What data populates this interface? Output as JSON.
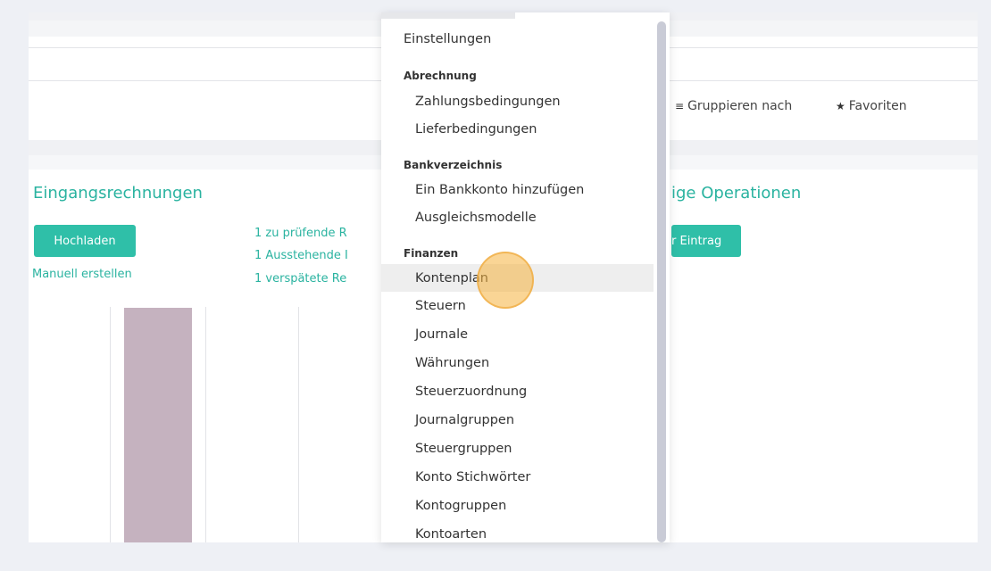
{
  "toolbar": {
    "group_by": "Gruppieren nach",
    "favorites": "Favoriten"
  },
  "incoming": {
    "title": "Eingangsrechnungen",
    "upload_button": "Hochladen",
    "manual_link": "Manuell erstellen",
    "links": [
      "1 zu prüfende R",
      "1 Ausstehende I",
      "1 verspätete Re"
    ]
  },
  "misc": {
    "title": "ige Operationen",
    "button": "r Eintrag"
  },
  "dropdown": {
    "settings": "Einstellungen",
    "groups": [
      {
        "header": "Abrechnung",
        "items": [
          "Zahlungsbedingungen",
          "Lieferbedingungen"
        ]
      },
      {
        "header": "Bankverzeichnis",
        "items": [
          "Ein Bankkonto hinzufügen",
          "Ausgleichsmodelle"
        ]
      },
      {
        "header": "Finanzen",
        "items": [
          "Kontenplan",
          "Steuern",
          "Journale",
          "Währungen",
          "Steuerzuordnung",
          "Journalgruppen",
          "Steuergruppen",
          "Konto Stichwörter",
          "Kontogruppen",
          "Kontoarten"
        ]
      }
    ]
  },
  "colors": {
    "accent": "#2ab3a0",
    "button": "#2fbfa8",
    "bar": "#c5b2bf",
    "highlight": "#f6b23e"
  }
}
